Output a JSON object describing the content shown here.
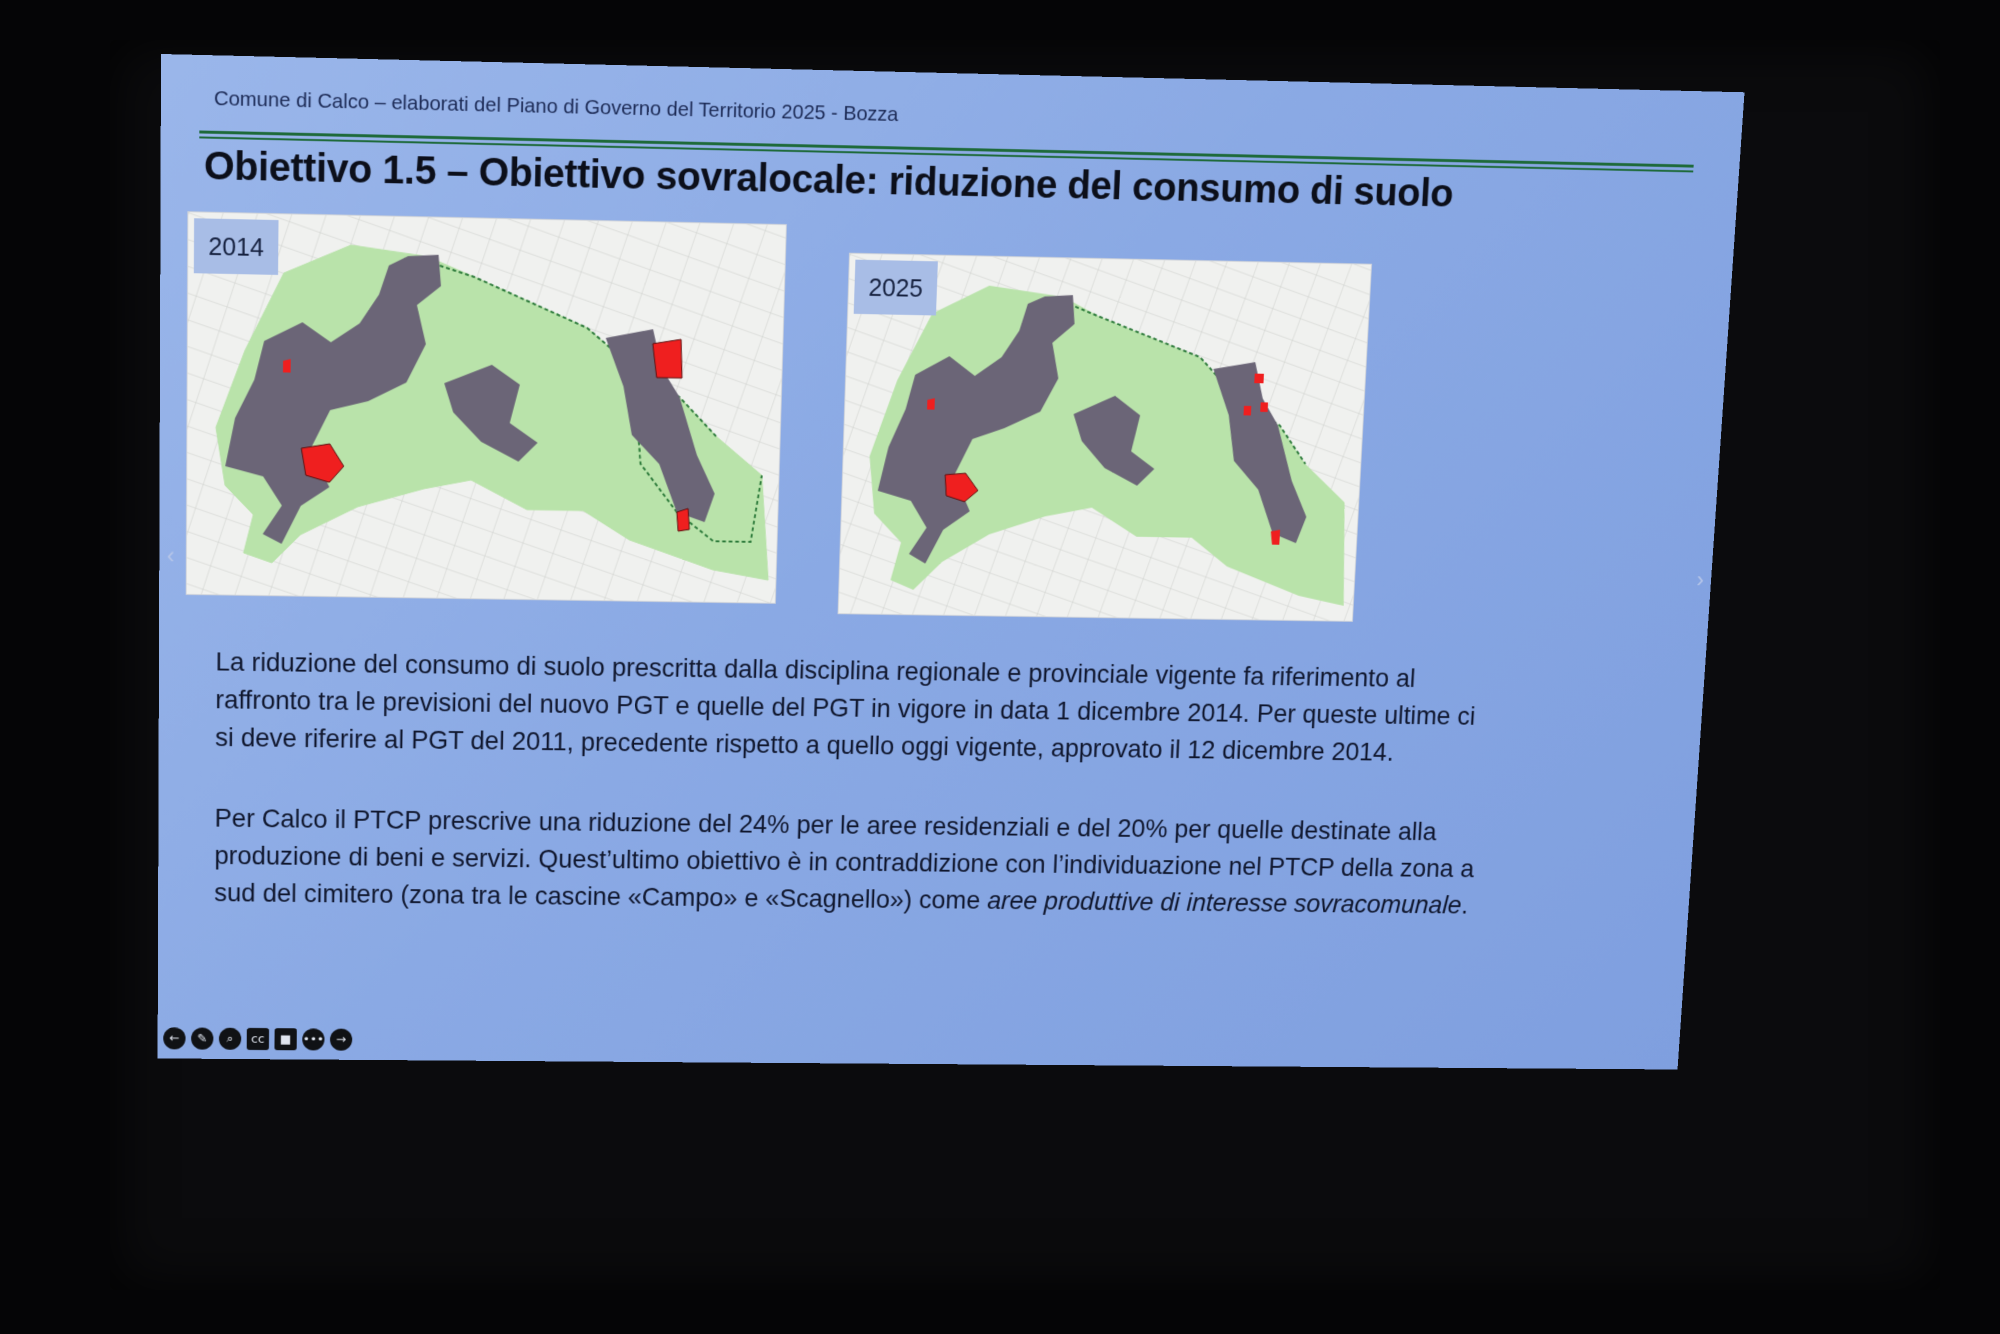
{
  "slide": {
    "header_text": "Comune di Calco – elaborati del Piano di Governo del Territorio 2025 - Bozza",
    "title": "Obiettivo 1.5 – Obiettivo sovralocale: riduzione del consumo di suolo",
    "maps": [
      {
        "year_label": "2014"
      },
      {
        "year_label": "2025"
      }
    ],
    "paragraph1_lines": [
      "La riduzione del consumo di suolo prescritta dalla disciplina regionale e provinciale vigente fa riferimento al",
      "raffronto tra le previsioni del nuovo PGT e quelle del PGT in vigore in data 1 dicembre 2014. Per queste ultime ci",
      "si deve riferire al PGT del 2011, precedente rispetto a quello oggi vigente, approvato il 12 dicembre 2014."
    ],
    "paragraph2_lines": [
      "Per Calco il PTCP prescrive una riduzione del 24% per le aree residenziali e del 20% per quelle destinate alla",
      "produzione di beni e servizi. Quest’ultimo obiettivo è in contraddizione con l’individuazione nel PTCP della zona a"
    ],
    "paragraph2_last_plain": "sud del cimitero (zona tra le cascine «Campo» e «Scagnello») come ",
    "paragraph2_last_italic": "aree produttive di interesse sovracomunale",
    "paragraph2_last_end": "."
  },
  "toolbar": {
    "icons": [
      "previous-slide-icon",
      "pen-icon",
      "zoom-icon",
      "subtitles-icon",
      "camera-icon",
      "more-icon",
      "next-slide-icon"
    ],
    "glyphs": [
      "←",
      "✎",
      "⌕",
      "cc",
      "■",
      "•••",
      "→"
    ]
  },
  "colors": {
    "slide_bg": "#8aa9e4",
    "accent_rule": "#1e6a3a",
    "urban_area": "#6b6577",
    "green_area": "#b7e4a8",
    "consumption_area": "#ef1f1f"
  }
}
